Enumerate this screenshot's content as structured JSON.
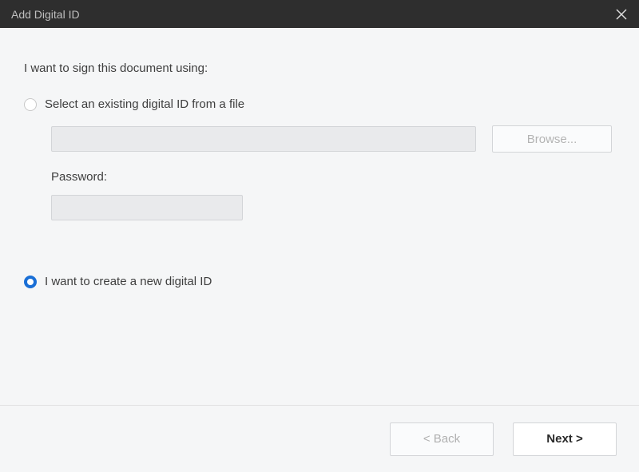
{
  "titlebar": {
    "title": "Add Digital ID"
  },
  "prompt": "I want to sign this document using:",
  "option_existing": {
    "label": "Select an existing digital ID from a file",
    "selected": false,
    "file_value": "",
    "browse_label": "Browse...",
    "password_label": "Password:",
    "password_value": ""
  },
  "option_create": {
    "label": "I want to create a new digital ID",
    "selected": true
  },
  "footer": {
    "back_label": "< Back",
    "next_label": "Next >"
  }
}
